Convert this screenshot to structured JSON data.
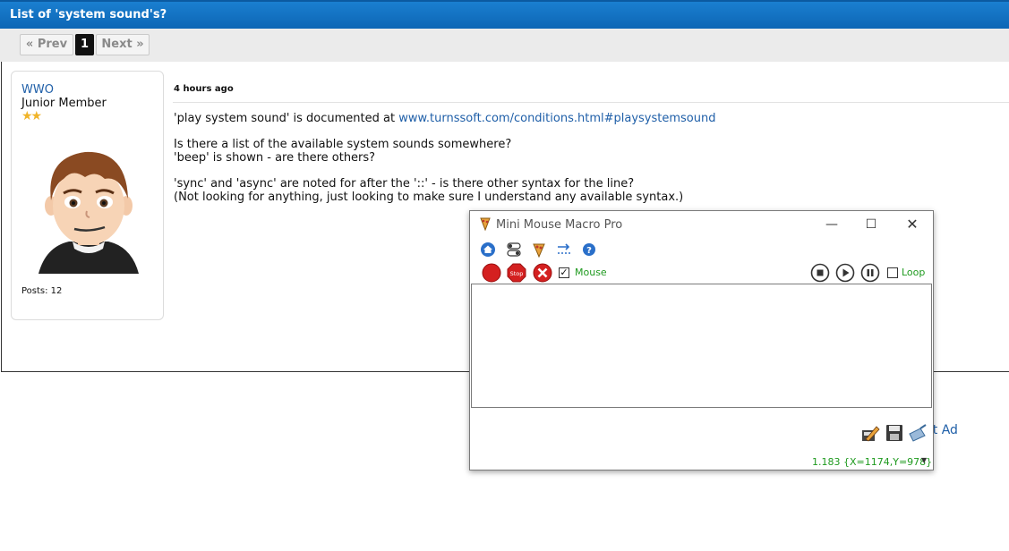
{
  "thread": {
    "title": "List of 'system sound's?"
  },
  "pager": {
    "prev_label": "« Prev",
    "current_page": "1",
    "next_label": "Next »"
  },
  "user": {
    "name": "WWO",
    "role": "Junior Member",
    "stars": "★★",
    "posts": "Posts: 12"
  },
  "post": {
    "time": "4 hours ago",
    "line1_text": "'play system sound' is documented at ",
    "line1_link": "www.turnssoft.com/conditions.html#playsystemsound",
    "line2": "Is there a list of the available system sounds somewhere?",
    "line3": "'beep' is shown - are there others?",
    "line4": "'sync' and 'async' are noted for after the '::' - is there other syntax for the line?",
    "line5": "(Not looking for anything, just looking to make sure I understand any available syntax.)"
  },
  "background_link": "rt Ad",
  "macro_window": {
    "title": "Mini Mouse Macro Pro",
    "minimize_glyph": "—",
    "maximize_glyph": "☐",
    "close_glyph": "✕",
    "stop_label": "Stop",
    "mouse_checkbox": {
      "label": "Mouse",
      "checked": true,
      "mark": "✓"
    },
    "loop_checkbox": {
      "label": "Loop",
      "checked": false
    },
    "status_text": "1.183  {X=1174,Y=978}",
    "status_caret": "▼"
  },
  "colors": {
    "header_blue": "#0d66b5",
    "link_blue": "#1f5fa8",
    "status_green": "#1f9a1f",
    "record_red": "#d42020"
  }
}
